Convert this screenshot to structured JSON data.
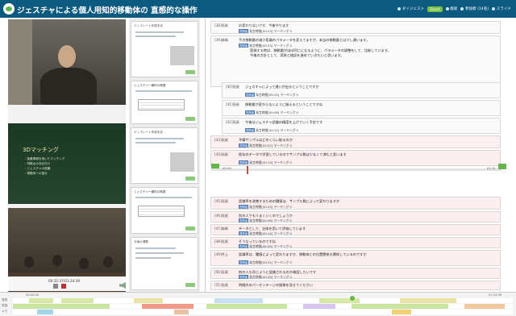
{
  "header": {
    "title": "ジェスチャによる個人用知的移動体の 直感的な操作",
    "menu": [
      "ダイジェスト",
      "Guest",
      "検索",
      "参加者 (14名)",
      "スライド"
    ]
  },
  "video": {
    "slide_title": "3Dマッチング",
    "slide_lines": [
      "・距離情報を用いたマッチング",
      "・特徴点の対応付け",
      "・ジェスチャの認識",
      "・移動体への指示"
    ],
    "timecode": "00:32:37/01:24:39"
  },
  "thumbs": [
    "テンプレート作成手法",
    "ジェスチャー識別の概要",
    "テンプレート作成手法",
    "ジェスチャー識別の概要",
    "今後の課題"
  ],
  "transcript": [
    {
      "speaker": "[38]長尾",
      "text": "お変わりないです、今後やります",
      "tag": "質問者",
      "meta": "発言時間[00:23] マーキング 0"
    },
    {
      "speaker": "[39]森嶋",
      "text": "手の移動量の減少距離のパラメータを変えてますが、本当の移動量とは少し違います。",
      "tag": "質問者",
      "meta": "発言時間[00:23] マーキング 0",
      "text2": "登録する時は、移動量がほぼ同じになるように、パラメータの調整をして、比較しています。",
      "text3": "今後の方針として、実装と検証を進めていきたいと思います。"
    },
    {
      "speaker": "[40]長尾",
      "text": "ジェスチャによって違いが出るということですか",
      "tag": "質問者",
      "meta": "発言時間[00:10] マーキング 0"
    },
    {
      "speaker": "[41]長尾",
      "text": "移動量が変わらないように揃えるということですね",
      "tag": "質問者",
      "meta": "発言時間[00:08] マーキング 0"
    },
    {
      "speaker": "[42]長尾",
      "text": "今後はジェスチャ認識の精度を上げていく予定です",
      "tag": "質問者",
      "meta": "発言時間[00:12] マーキング 0"
    },
    {
      "speaker": "[43]長尾",
      "text": "予備サンプルはどのくらい取るのか",
      "tag": "質問者",
      "meta": "発言時間[00:07] マーキング 0"
    },
    {
      "speaker": "[44]長尾",
      "text": "既存のデータで学習しているのでサンプル数は少なくて済むと思います",
      "tag": "質問者",
      "meta": "発言時間[00:15] マーキング 0"
    },
    {
      "speaker": "[45]長尾",
      "text": "認識率を改善するための閾値は、サンプル数によって変わりますか",
      "tag": "質問者",
      "meta": "発言時間[00:23] マーキング 0"
    },
    {
      "speaker": "[46]長尾",
      "text": "別の人でもうまくいくのでしょうか",
      "tag": "質問者",
      "meta": "発言時間[00:06] マーキング 0"
    },
    {
      "speaker": "[47]森嶋",
      "text": "データとして、全体を用いて評価しています",
      "tag": "発表者",
      "meta": "発言時間[00:14] マーキング 0"
    },
    {
      "speaker": "[48]長尾",
      "text": "そうなっているのですね",
      "tag": "質問者",
      "meta": "発言時間[00:09] マーキング 0"
    },
    {
      "speaker": "[49]井上",
      "text": "認識率は、閾値によって変わりますか、移動体との位置関係も関係しているのですか",
      "tag": "質問者",
      "meta": "発言時間[00:31] マーキング 0"
    },
    {
      "speaker": "[50]長尾",
      "text": "他の人も同じように認識されるのか確認したいです",
      "tag": "質問者",
      "meta": "発言時間[00:45] マーキング 0"
    },
    {
      "speaker": "[51]長尾",
      "text": "時間外のパーセンテージの推移を見せてください"
    }
  ],
  "seek": {
    "start": "00:00",
    "end": "01:31"
  },
  "timeline": {
    "start": "00:00:00",
    "end": "01:24:39",
    "rows": [
      "発表",
      "質疑",
      "メモ"
    ]
  }
}
